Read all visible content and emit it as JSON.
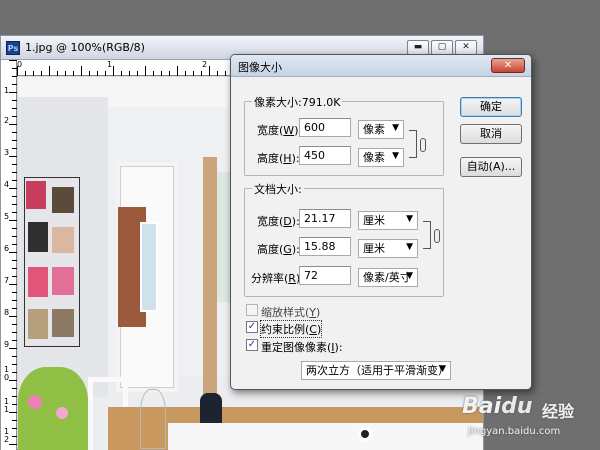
{
  "document": {
    "title": "1.jpg @ 100%(RGB/8)",
    "ps_icon": "Ps",
    "controls": {
      "minimize": "▬",
      "maximize": "▢",
      "close": "✕"
    },
    "ruler_top": [
      "0",
      "1",
      "2"
    ],
    "ruler_left": [
      "1",
      "2",
      "3",
      "4",
      "5",
      "6",
      "7",
      "8",
      "9",
      "1\n0",
      "1\n1",
      "1\n2"
    ]
  },
  "dialog": {
    "title": "图像大小",
    "close": "✕",
    "pixel_size": {
      "legend": "像素大小:791.0K",
      "width_label": "宽度(",
      "width_key": "W",
      "height_label": "高度(",
      "height_key": "H",
      "label_suffix": "):",
      "width_value": "600",
      "height_value": "450",
      "width_unit": "像素",
      "height_unit": "像素"
    },
    "document_size": {
      "legend": "文档大小:",
      "width_label": "宽度(",
      "width_key": "D",
      "height_label": "高度(",
      "height_key": "G",
      "res_label": "分辨率(",
      "res_key": "R",
      "label_suffix": "):",
      "width_value": "21.17",
      "height_value": "15.88",
      "res_value": "72",
      "width_unit": "厘米",
      "height_unit": "厘米",
      "res_unit": "像素/英寸"
    },
    "options": {
      "scale_styles": "缩放样式(",
      "scale_styles_key": "Y",
      "constrain": "约束比例(",
      "constrain_key": "C",
      "resample": "重定图像像素(",
      "resample_key": "I",
      "close_paren": ")",
      "resample_suffix": "):",
      "scale_styles_checked": false,
      "constrain_checked": true,
      "resample_checked": true,
      "method": "两次立方（适用于平滑渐变）"
    },
    "buttons": {
      "ok": "确定",
      "cancel": "取消",
      "auto": "自动(A)..."
    },
    "check_glyph": "✓",
    "dropdown_arrow": "▼"
  },
  "watermark": {
    "brand": "Bai",
    "paw": "du",
    "label": "经验",
    "url": "jingyan.baidu.com"
  },
  "colors": {
    "accent": "#3c7fb1",
    "background": "#6f6f6f",
    "dialog": "#f1f1f1",
    "close": "#c8442f"
  }
}
